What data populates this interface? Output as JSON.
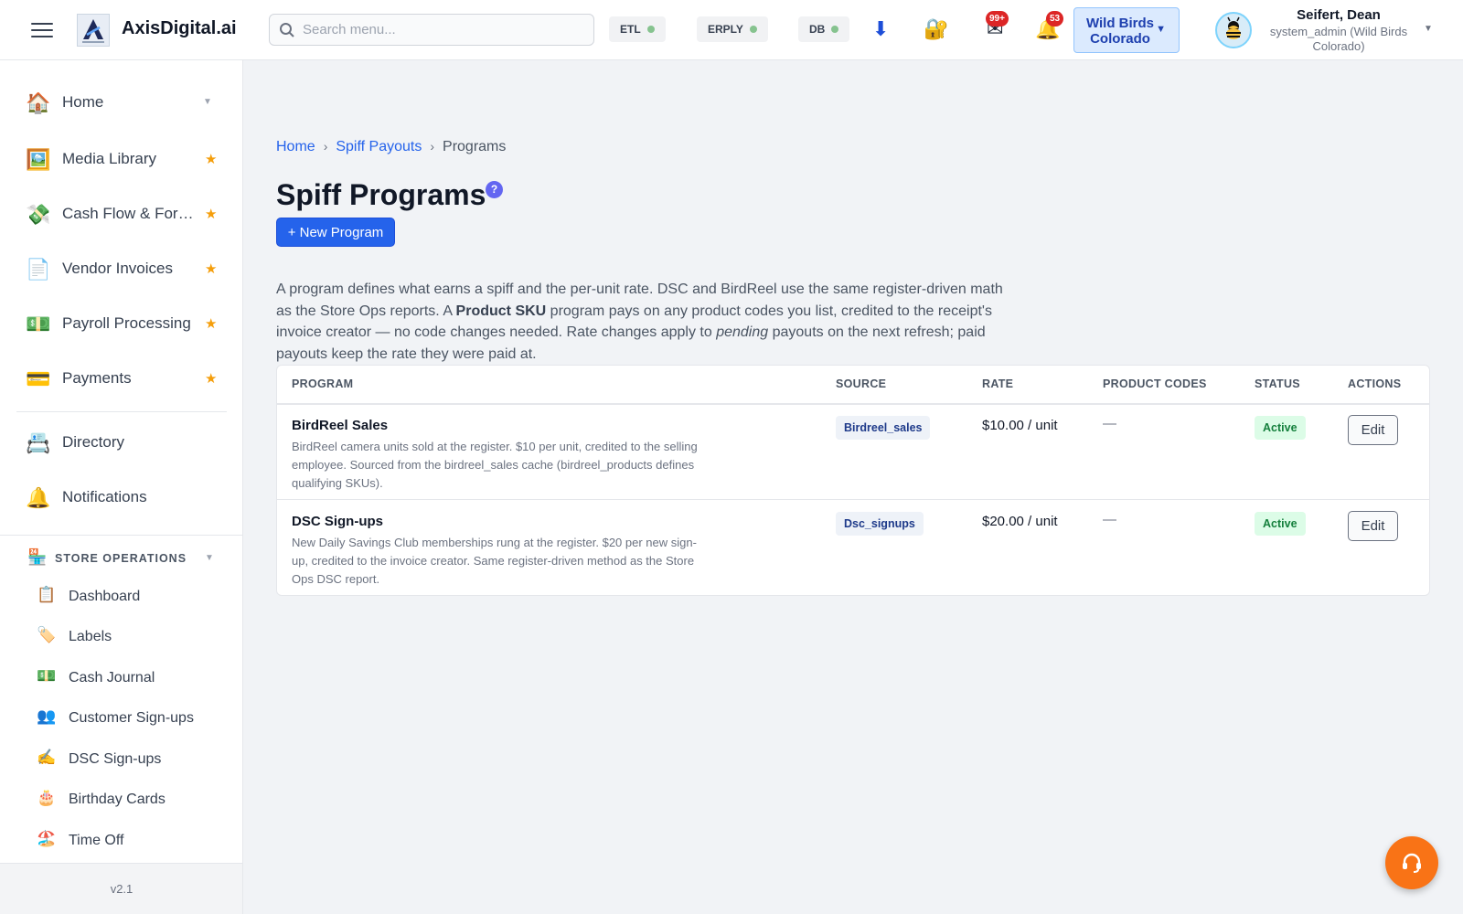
{
  "header": {
    "brand": "AxisDigital.ai",
    "search_placeholder": "Search menu...",
    "status": {
      "etl": "ETL",
      "erply": "ERPLY",
      "db": "DB",
      "ok_color": "#86c38f"
    },
    "mail_badge": "99+",
    "bell_badge": "53",
    "store_name": "Wild Birds Colorado",
    "user_name": "Seifert, Dean",
    "user_role": "system_admin (Wild Birds Colorado)"
  },
  "sidebar": {
    "items": [
      {
        "label": "Home",
        "icon": "🏠"
      },
      {
        "label": "Media Library",
        "icon": "🖼️"
      },
      {
        "label": "Cash Flow & For…",
        "icon": "💸"
      },
      {
        "label": "Vendor Invoices",
        "icon": "📄"
      },
      {
        "label": "Payroll Processing",
        "icon": "💵"
      },
      {
        "label": "Payments",
        "icon": "💳"
      },
      {
        "label": "Directory",
        "icon": "📇"
      },
      {
        "label": "Notifications",
        "icon": "🔔"
      }
    ],
    "section_label": "STORE OPERATIONS",
    "section_icon": "🏪",
    "sub_items": [
      {
        "label": "Dashboard",
        "icon": "📋"
      },
      {
        "label": "Labels",
        "icon": "🏷️"
      },
      {
        "label": "Cash Journal",
        "icon": "💵"
      },
      {
        "label": "Customer Sign-ups",
        "icon": "👥"
      },
      {
        "label": "DSC Sign-ups",
        "icon": "✍️"
      },
      {
        "label": "Birthday Cards",
        "icon": "🎂"
      },
      {
        "label": "Time Off",
        "icon": "🏖️"
      }
    ],
    "version": "v2.1",
    "star_color": "#f59e0b"
  },
  "breadcrumb": {
    "home": "Home",
    "parent": "Spiff Payouts",
    "current": "Programs"
  },
  "page": {
    "title": "Spiff Programs",
    "help": "?",
    "new_button": "+ New Program",
    "desc": {
      "p1": "A program defines what earns a spiff and the per-unit rate. DSC and BirdReel use the same register-driven math as the Store Ops reports. A ",
      "b1": "Product SKU",
      "p2": " program pays on any product codes you list, credited to the receipt's invoice creator — no code changes needed. Rate changes apply to ",
      "i1": "pending",
      "p3": " payouts on the next refresh; paid payouts keep the rate they were paid at."
    }
  },
  "table": {
    "columns": [
      "PROGRAM",
      "SOURCE",
      "RATE",
      "PRODUCT CODES",
      "STATUS",
      "ACTIONS"
    ],
    "rows": [
      {
        "name": "BirdReel Sales",
        "desc": "BirdReel camera units sold at the register. $10 per unit, credited to the selling employee. Sourced from the birdreel_sales cache (birdreel_products defines qualifying SKUs).",
        "source": "Birdreel_sales",
        "rate": "$10.00 / unit",
        "codes": "—",
        "status": "Active",
        "action": "Edit"
      },
      {
        "name": "DSC Sign-ups",
        "desc": "New Daily Savings Club memberships rung at the register. $20 per new sign-up, credited to the invoice creator. Same register-driven method as the Store Ops DSC report.",
        "source": "Dsc_signups",
        "rate": "$20.00 / unit",
        "codes": "—",
        "status": "Active",
        "action": "Edit"
      }
    ]
  },
  "colors": {
    "accent": "#2563eb",
    "help": "#6366f1",
    "active_bg": "#dcfce7",
    "active_text": "#15803d",
    "fab": "#f97316",
    "badge": "#dc2626"
  }
}
